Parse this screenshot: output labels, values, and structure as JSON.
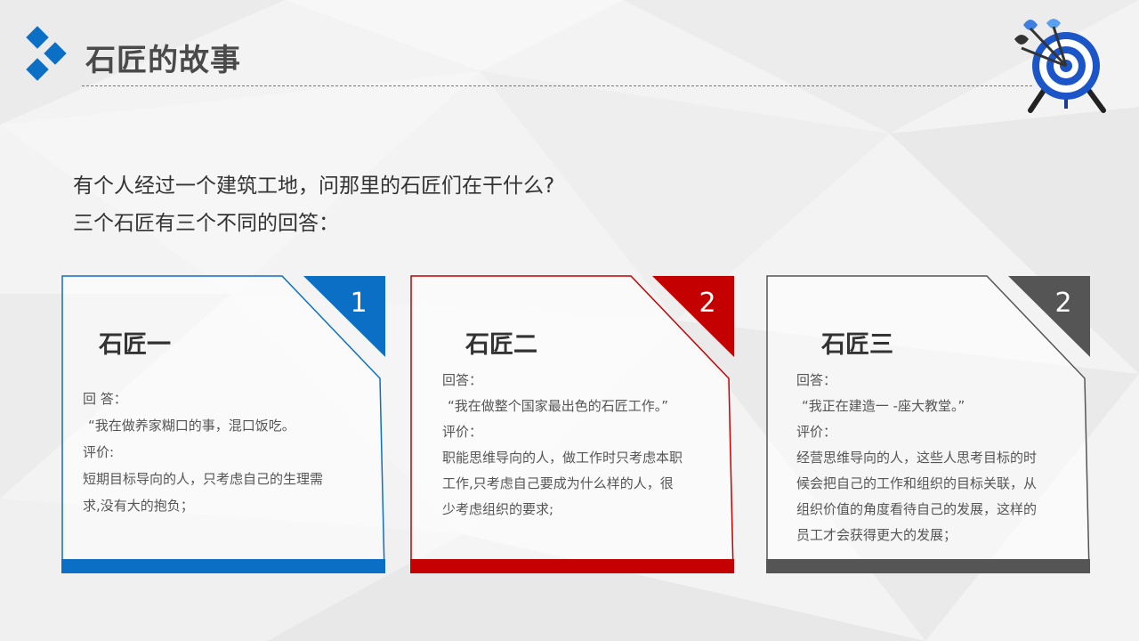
{
  "slide": {
    "title": "石匠的故事",
    "intro": [
      "有个人经过一个建筑工地，问那里的石匠们在干什么?",
      "三个石匠有三个不同的回答："
    ]
  },
  "colors": {
    "blue": "#0b6fc6",
    "red": "#c40000",
    "gray": "#555555"
  },
  "icons": {
    "logo": "diamond-cluster-icon",
    "target": "dartboard-icon"
  },
  "cards": [
    {
      "number": "1",
      "name": "石匠一",
      "lines": [
        "回 答：",
        "“我在做养家糊口的事，混口饭吃。",
        "评价:",
        "短期目标导向的人，只考虑自己的生理需",
        "求,没有大的抱负；"
      ]
    },
    {
      "number": "2",
      "name": "石匠二",
      "lines": [
        "回答：",
        "“我在做整个国家最出色的石匠工作。”",
        "评价：",
        "职能思维导向的人，做工作时只考虑本职",
        "工作,只考虑自己要成为什么样的人，很",
        "少考虑组织的要求;"
      ]
    },
    {
      "number": "2",
      "name": "石匠三",
      "lines": [
        "回答：",
        "“我正在建造一 -座大教堂。”",
        "评价：",
        "经营思维导向的人，这些人思考目标的时",
        "候会把自己的工作和组织的目标关联，从",
        "组织价值的角度看待自己的发展，这样的",
        "员工才会获得更大的发展；"
      ]
    }
  ]
}
